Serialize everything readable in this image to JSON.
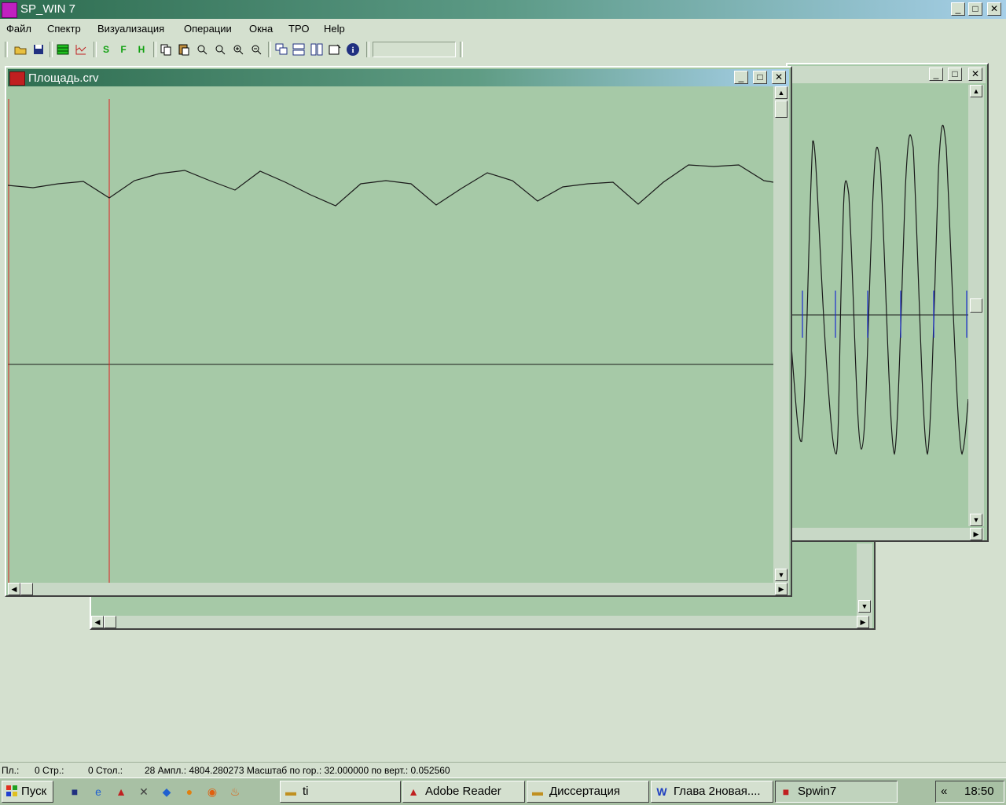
{
  "app": {
    "title": "SP_WIN 7"
  },
  "menu": [
    "Файл",
    "Спектр",
    "Визуализация",
    "Операции",
    "Окна",
    "ТРО",
    "Help"
  ],
  "caption_buttons": {
    "minimize": "_",
    "maximize": "□",
    "close": "✕"
  },
  "windows": {
    "main": {
      "title": "Площадь.crv"
    },
    "back": {
      "title": ""
    }
  },
  "status": {
    "pl": "Пл.:",
    "str": "0 Стр.:",
    "stol": "0 Стол.:",
    "rest": "28 Ампл.: 4804.280273 Масштаб по гор.: 32.000000 по верт.: 0.052560"
  },
  "taskbar": {
    "start": "Пуск",
    "tasks": [
      "ti",
      "Adobe Reader",
      "Диссертация",
      "Глава 2новая....",
      "Spwin7"
    ],
    "tray_chevron": "«",
    "clock": "18:50"
  },
  "icons": {
    "toolbar": [
      "open-folder-icon",
      "save-icon",
      "grid-icon",
      "spectrum-icon",
      "s-icon",
      "f-icon",
      "h-icon",
      "copy-icon",
      "paste-icon",
      "zoom-x-icon",
      "zoom-y-icon",
      "zoom-in-icon",
      "zoom-out-icon",
      "cascade-icon",
      "tile-h-icon",
      "tile-v-icon",
      "properties-icon",
      "info-icon"
    ]
  },
  "colors": {
    "plot_bg": "#a6c9a7",
    "cursor": "#e02020",
    "curve": "#1a1a1a",
    "marker": "#1a2ad0",
    "title_active": "#2e6d50"
  }
}
